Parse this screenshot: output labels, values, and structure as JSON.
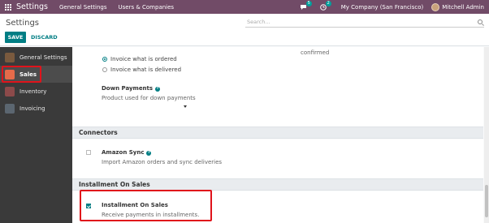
{
  "navbar": {
    "brand": "Settings",
    "menus": [
      "General Settings",
      "Users & Companies"
    ],
    "messages_count": "5",
    "activities_count": "2",
    "company": "My Company (San Francisco)",
    "user": "Mitchell Admin"
  },
  "control_panel": {
    "title": "Settings",
    "search_placeholder": "Search...",
    "save_label": "SAVE",
    "discard_label": "DISCARD"
  },
  "sidebar": {
    "items": [
      {
        "label": "General Settings",
        "icon": "general-settings-icon",
        "color": "#7a5a3e"
      },
      {
        "label": "Sales",
        "icon": "sales-icon",
        "color": "#e56b4a",
        "active": true
      },
      {
        "label": "Inventory",
        "icon": "inventory-icon",
        "color": "#8c4a4a"
      },
      {
        "label": "Invoicing",
        "icon": "invoicing-icon",
        "color": "#5b6670"
      }
    ]
  },
  "invoicing_policy": {
    "right_text": "confirmed",
    "options": [
      {
        "label": "Invoice what is ordered",
        "selected": true
      },
      {
        "label": "Invoice what is delivered",
        "selected": false
      }
    ]
  },
  "down_payments": {
    "title": "Down Payments",
    "help": "?",
    "description": "Product used for down payments"
  },
  "connectors": {
    "heading": "Connectors",
    "amazon": {
      "title": "Amazon Sync",
      "help": "?",
      "description": "Import Amazon orders and sync deliveries",
      "checked": false
    }
  },
  "installment": {
    "heading": "Installment On Sales",
    "title": "Installment On Sales",
    "description": "Receive payments in installments.",
    "checked": true
  },
  "colors": {
    "navbar": "#714b67",
    "accent": "#017e84",
    "highlight": "#e0131b"
  }
}
